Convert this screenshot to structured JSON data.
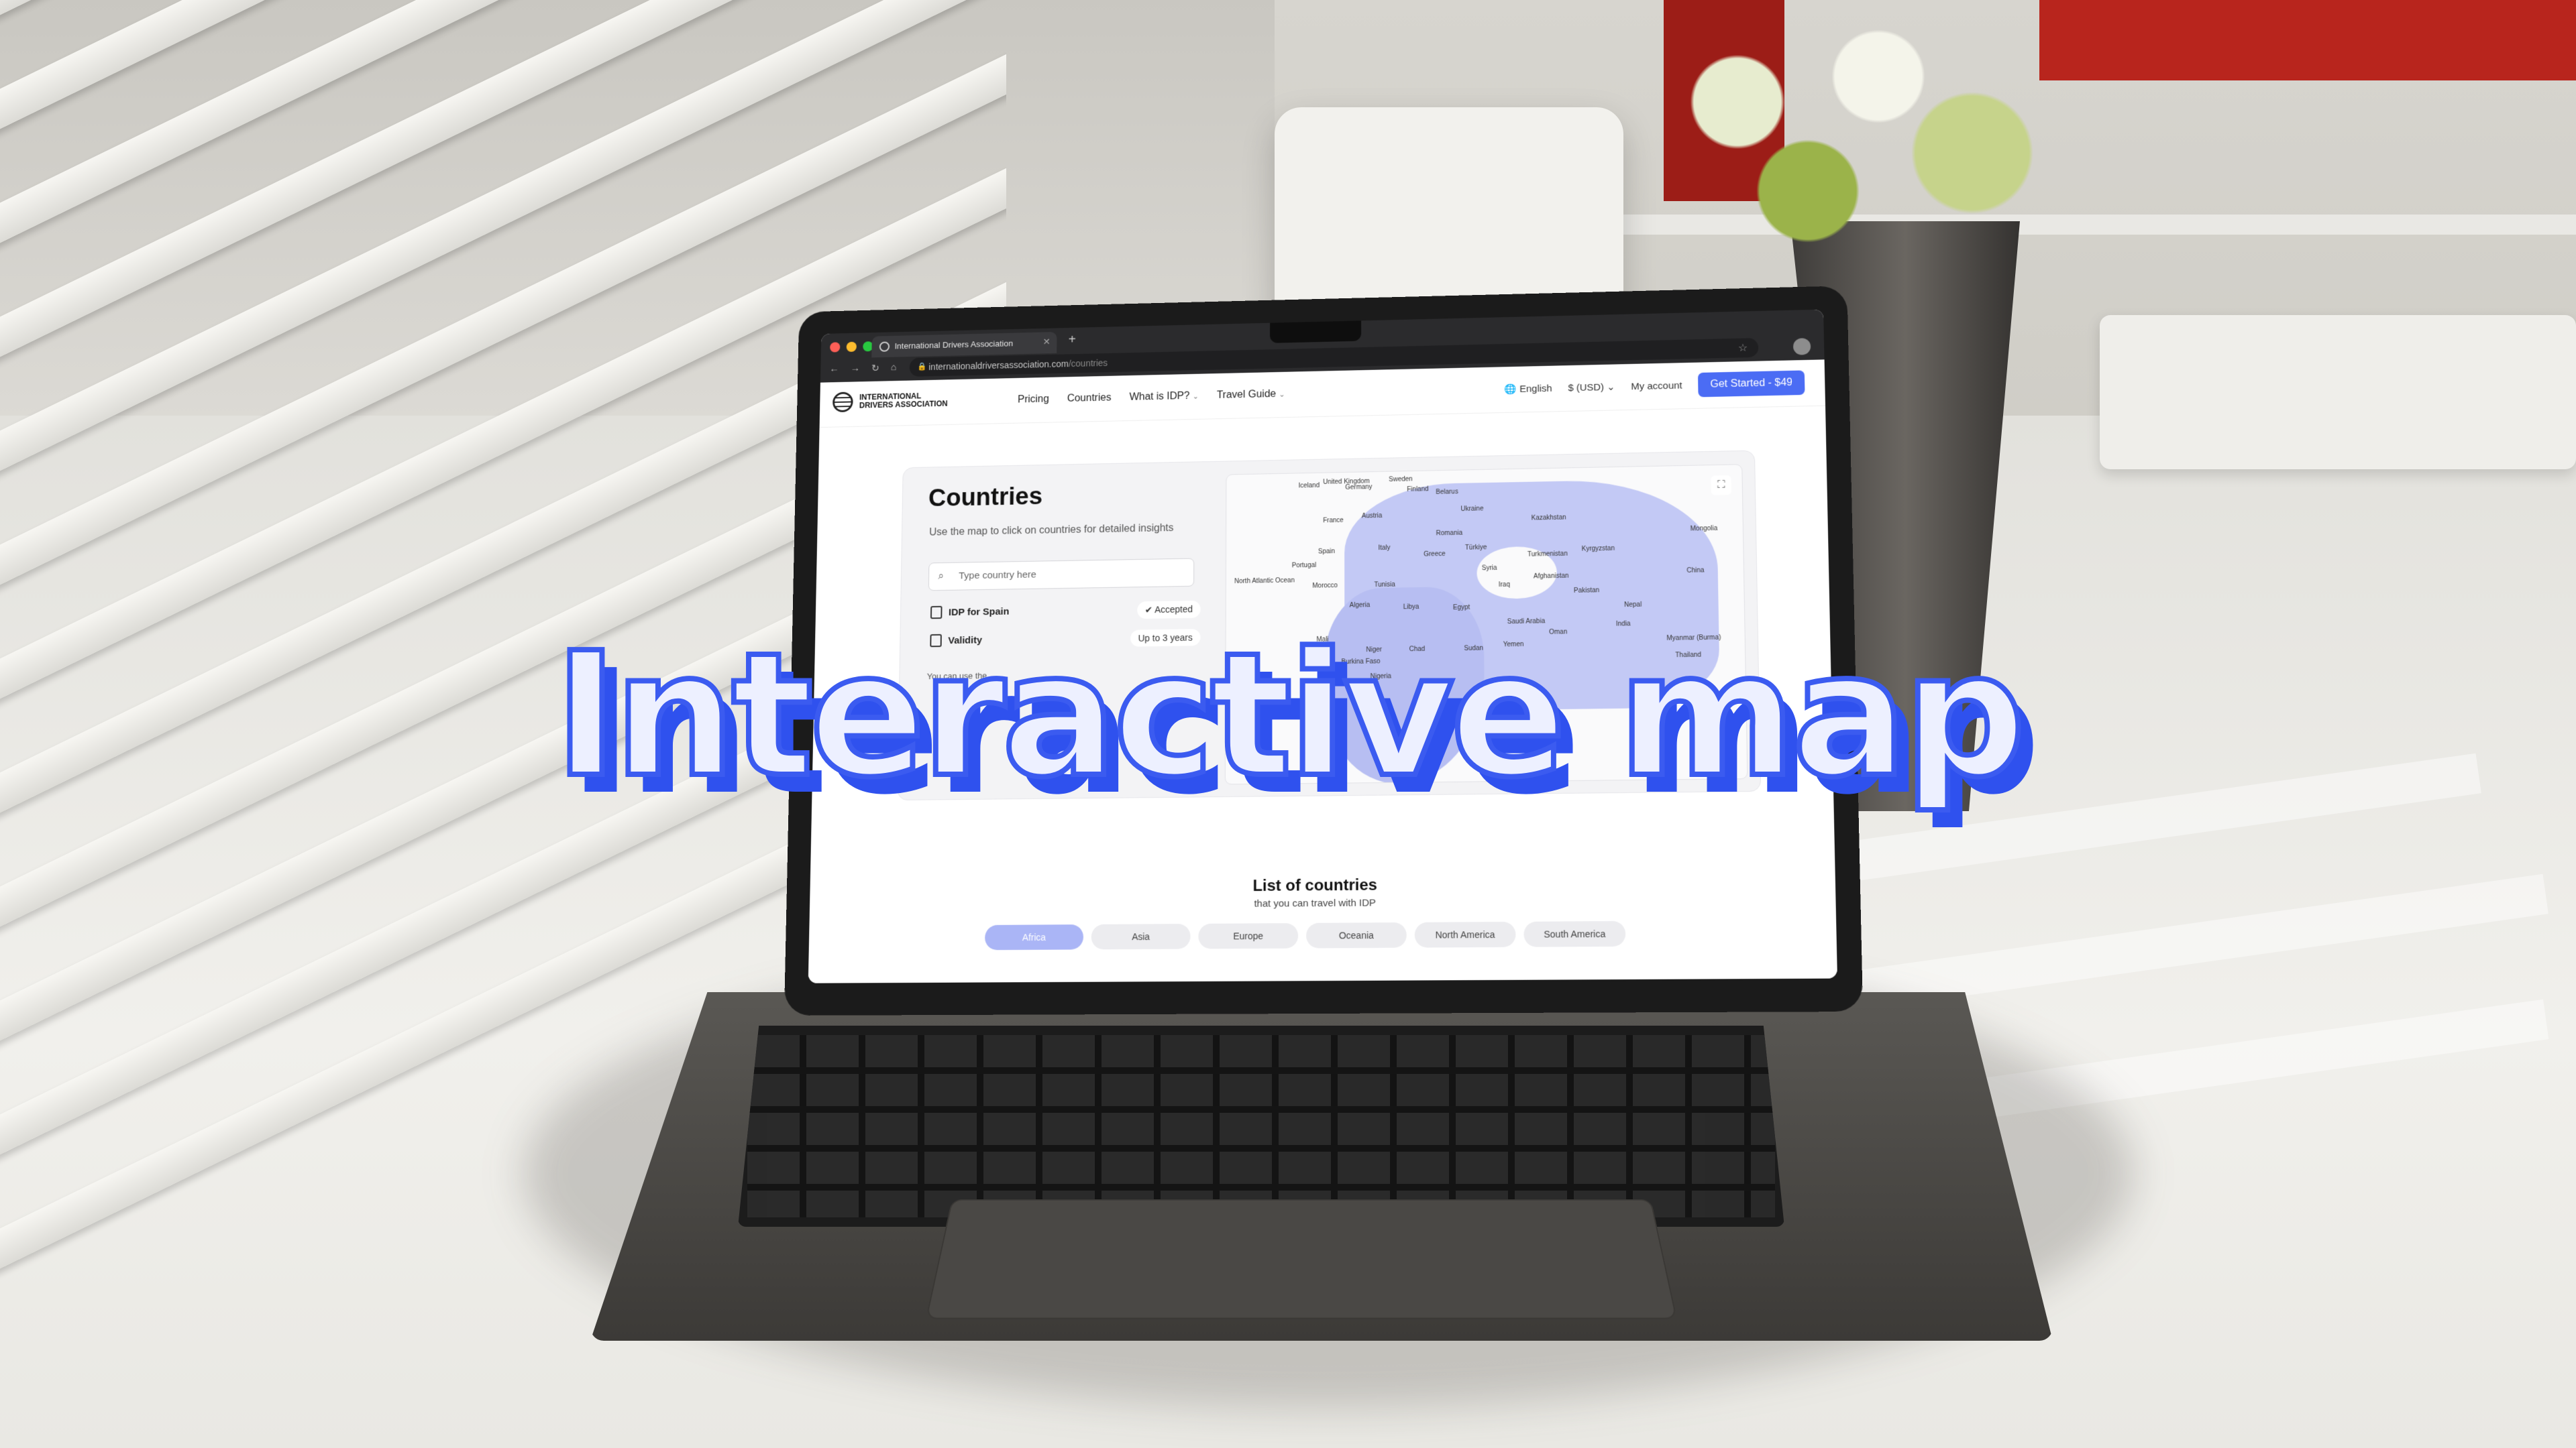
{
  "overlay": {
    "headline": "Interactive map"
  },
  "browser": {
    "tab_title": "International Drivers Association",
    "url_host": "internationaldriversassociation.com",
    "url_path": "/countries"
  },
  "site": {
    "logo_line1": "INTERNATIONAL",
    "logo_line2": "DRIVERS ASSOCIATION",
    "nav": {
      "pricing": "Pricing",
      "countries": "Countries",
      "what_is_idp": "What is IDP?",
      "travel_guide": "Travel Guide"
    },
    "language": "English",
    "currency": "$ (USD)",
    "account": "My account",
    "cta": "Get Started - $49"
  },
  "countries_card": {
    "title": "Countries",
    "subtitle": "Use the map to click on countries for detailed insights",
    "search_placeholder": "Type country here",
    "idp_label": "IDP for Spain",
    "idp_status": "Accepted",
    "validity_label": "Validity",
    "validity_value": "Up to 3 years",
    "note": "You can use the"
  },
  "map": {
    "labels": [
      "Iceland",
      "United Kingdom",
      "Germany",
      "Sweden",
      "Finland",
      "Belarus",
      "Ukraine",
      "France",
      "Austria",
      "Kazakhstan",
      "Romania",
      "Mongolia",
      "Spain",
      "Italy",
      "Greece",
      "Türkiye",
      "Turkmenistan",
      "Kyrgyzstan",
      "Portugal",
      "Syria",
      "Afghanistan",
      "China",
      "Morocco",
      "Tunisia",
      "Iraq",
      "Pakistan",
      "Algeria",
      "Libya",
      "Egypt",
      "Nepal",
      "Saudi Arabia",
      "India",
      "Oman",
      "Mali",
      "Niger",
      "Chad",
      "Sudan",
      "Yemen",
      "Myanmar (Burma)",
      "Thailand",
      "Burkina Faso",
      "Nigeria",
      "North Atlantic Ocean",
      "Madagascar",
      "Botswana"
    ]
  },
  "list": {
    "title": "List of countries",
    "subtitle": "that you can travel with IDP",
    "regions": [
      "Africa",
      "Asia",
      "Europe",
      "Oceania",
      "North America",
      "South America"
    ],
    "active_region": "Africa"
  },
  "colors": {
    "accent": "#4b6cf4",
    "overlay_fill": "#edf0ff",
    "overlay_stroke": "#3b5bf0",
    "map_land": "#c3c9f5"
  }
}
